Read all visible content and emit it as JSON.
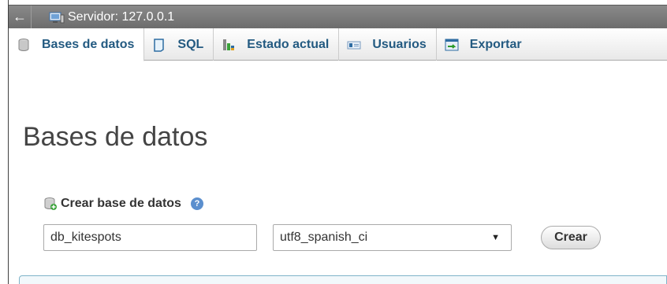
{
  "server_bar": {
    "back_icon": "left-arrow-icon",
    "server_icon": "server-icon",
    "title": "Servidor: 127.0.0.1"
  },
  "tabs": [
    {
      "label": "Bases de datos",
      "icon": "database-icon",
      "active": true
    },
    {
      "label": "SQL",
      "icon": "sql-icon",
      "active": false
    },
    {
      "label": "Estado actual",
      "icon": "status-chart-icon",
      "active": false
    },
    {
      "label": "Usuarios",
      "icon": "users-icon",
      "active": false
    },
    {
      "label": "Exportar",
      "icon": "export-icon",
      "active": false
    }
  ],
  "page": {
    "title": "Bases de datos"
  },
  "create_db": {
    "label": "Crear base de datos",
    "help_icon": "help-icon",
    "name_value": "db_kitespots",
    "collation_value": "utf8_spanish_ci",
    "button_label": "Crear"
  },
  "colors": {
    "link": "#235a81",
    "server_bar": "#7a7a7a",
    "title": "#444444"
  }
}
